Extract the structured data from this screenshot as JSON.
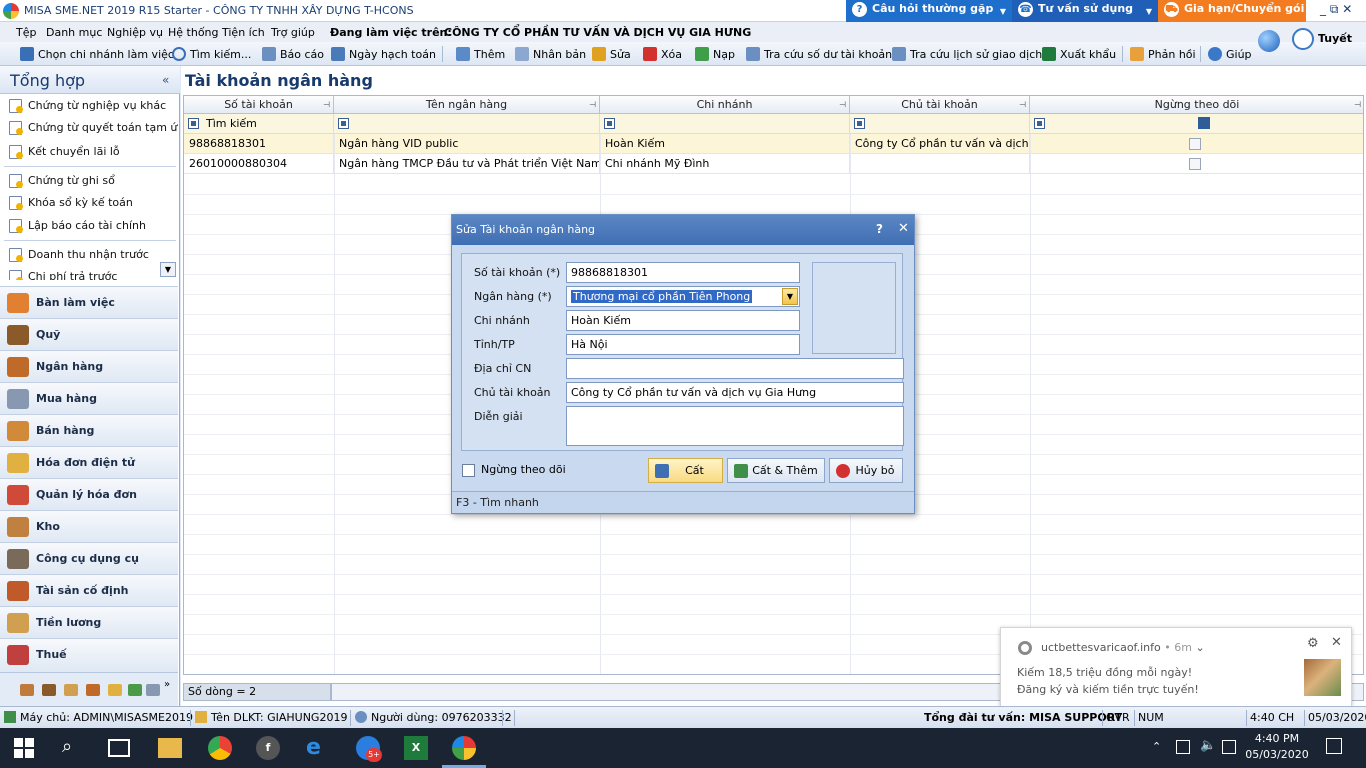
{
  "titlebar": {
    "title": "MISA SME.NET 2019 R15 Starter - CÔNG TY TNHH XÂY DỰNG T-HCONS",
    "tabs": [
      {
        "label": "Câu hỏi thường gặp",
        "color": "#1e6ecc"
      },
      {
        "label": "Tư vấn sử dụng",
        "color": "#1f5fb8"
      },
      {
        "label": "Gia hạn/Chuyển gói",
        "color": "#f47c20"
      }
    ],
    "window_controls": "_ ⧉ ✕"
  },
  "menubar": {
    "items": [
      "Tệp",
      "Danh mục",
      "Nghiệp vụ",
      "Hệ thống",
      "Tiện ích",
      "Trợ giúp"
    ],
    "working_on_label": "Đang làm việc trên:",
    "company": "CÔNG TY CỔ PHẦN TƯ VẤN VÀ DỊCH VỤ GIA HƯNG"
  },
  "toolbar": {
    "items": [
      "Chọn chi nhánh làm việc",
      "Tìm kiếm...",
      "Báo cáo",
      "Ngày hạch toán",
      "Thêm",
      "Nhân bản",
      "Sửa",
      "Xóa",
      "Nạp",
      "Tra cứu số dư tài khoản",
      "Tra cứu lịch sử giao dịch",
      "Xuất khẩu",
      "Phản hồi",
      "Giúp"
    ],
    "user": "Tuyết"
  },
  "sidebar": {
    "title": "Tổng hợp",
    "links": [
      "Chứng từ nghiệp vụ khác",
      "Chứng từ quyết toán tạm ứn...",
      "Kết chuyển lãi lỗ",
      "Chứng từ ghi sổ",
      "Khóa sổ kỳ kế toán",
      "Lập báo cáo tài chính",
      "Doanh thu nhận trước",
      "Chi phí trả trước"
    ],
    "modules": [
      "Bàn làm việc",
      "Quỹ",
      "Ngân hàng",
      "Mua hàng",
      "Bán hàng",
      "Hóa đơn điện tử",
      "Quản lý hóa đơn",
      "Kho",
      "Công cụ dụng cụ",
      "Tài sản cố định",
      "Tiền lương",
      "Thuế"
    ]
  },
  "main": {
    "title": "Tài khoản ngân hàng",
    "columns": [
      "Số tài khoản",
      "Tên ngân hàng",
      "Chi nhánh",
      "Chủ tài khoản",
      "Ngừng theo dõi"
    ],
    "search_placeholder": "Tìm kiếm",
    "rows": [
      {
        "account": "98868818301",
        "bank": "Ngân hàng VID public",
        "branch": "Hoàn Kiếm",
        "owner": "Công ty Cổ phần tư vấn và dịch v"
      },
      {
        "account": "26010000880304",
        "bank": "Ngân hàng TMCP Đầu tư và Phát triển Việt Nam",
        "branch": "Chi nhánh Mỹ Đình",
        "owner": ""
      }
    ],
    "row_count": "Số dòng = 2"
  },
  "dialog": {
    "title": "Sửa Tài khoản ngân hàng",
    "help": "?",
    "close": "✕",
    "fields": {
      "account_label": "Số tài khoản (*)",
      "account_value": "98868818301",
      "bank_label": "Ngân hàng (*)",
      "bank_value": "Thương mại cổ phần Tiên Phong",
      "branch_label": "Chi nhánh",
      "branch_value": "Hoàn Kiếm",
      "city_label": "Tỉnh/TP",
      "city_value": "Hà Nội",
      "address_label": "Địa chỉ CN",
      "address_value": "",
      "owner_label": "Chủ tài khoản",
      "owner_value": "Công ty Cổ phần tư vấn và dịch vụ Gia Hưng",
      "desc_label": "Diễn giải",
      "desc_value": ""
    },
    "stop_tracking_label": "Ngừng theo dõi",
    "buttons": {
      "save": "Cất",
      "save_add": "Cất & Thêm",
      "cancel": "Hủy bỏ"
    },
    "footer": "F3 - Tìm nhanh"
  },
  "notification": {
    "source": "uctbettesvaricaof.info",
    "time": "• 6m",
    "line1": "Kiếm 18,5 triệu đồng mỗi ngày!",
    "line2": "Đăng ký và kiếm tiền trực tuyến!"
  },
  "statusbar": {
    "server": "Máy chủ: ADMIN\\MISASME2019",
    "db": "Tên DLKT: GIAHUNG2019",
    "user": "Người dùng: 0976203332",
    "hotline": "Tổng đài tư vấn: MISA SUPPORT",
    "ovr": "OVR",
    "num": "NUM",
    "time": "4:40 CH",
    "date": "05/03/2020"
  },
  "taskbar": {
    "time": "4:40 PM",
    "date": "05/03/2020",
    "badge": "5+"
  }
}
